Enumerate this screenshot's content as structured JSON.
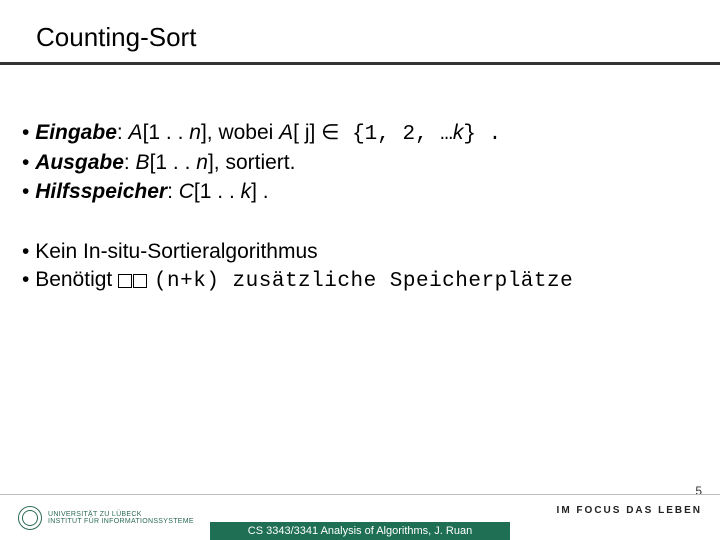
{
  "title": "Counting-Sort",
  "bullets": {
    "line1": {
      "label": "Eingabe",
      "pre": ": ",
      "arr": "A",
      "range": "[1 . . ",
      "nvar": "n",
      "post": "], wobei ",
      "arr2": "A",
      "idx": "[ j] ∈",
      "set": "{1, 2, …",
      "kvar": "k",
      "tail": "} ."
    },
    "line2": {
      "label": "Ausgabe",
      "pre": ": ",
      "arr": "B",
      "range": "[1 . . ",
      "nvar": "n",
      "post": "], sortiert."
    },
    "line3": {
      "label": "Hilfsspeicher",
      "pre": ": ",
      "arr": "C",
      "range": "[1 . . ",
      "kvar": "k",
      "post": "] ."
    },
    "line4": "Kein In-situ-Sortieralgorithmus",
    "line5_tail": "(n+k) zusätzliche Speicherplätze",
    "line5_pre": "Benötigt "
  },
  "footer": {
    "logo_line1": "UNIVERSITÄT ZU LÜBECK",
    "logo_line2": "INSTITUT FÜR INFORMATIONSSYSTEME",
    "motto": "IM FOCUS DAS LEBEN",
    "page": "5",
    "caption": "CS 3343/3341 Analysis of Algorithms, J. Ruan"
  }
}
